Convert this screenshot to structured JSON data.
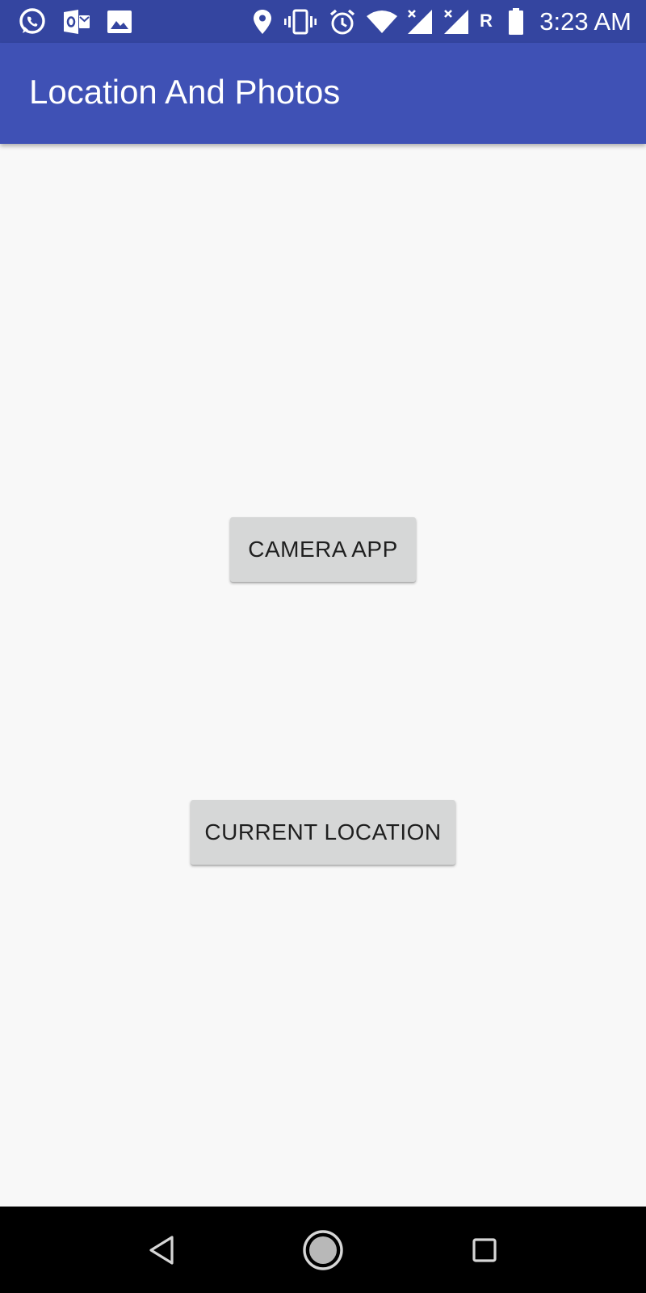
{
  "status_bar": {
    "left_icons": [
      "whatsapp-icon",
      "outlook-icon",
      "gallery-icon"
    ],
    "right_icons": [
      "location-pin-icon",
      "vibrate-icon",
      "alarm-icon",
      "wifi-icon",
      "signal-icon",
      "signal-icon",
      "roaming-indicator",
      "battery-icon"
    ],
    "roaming_label": "R",
    "time": "3:23 AM",
    "color": "#3445a0"
  },
  "app_bar": {
    "title": "Location And Photos",
    "color": "#3f51b5"
  },
  "main": {
    "buttons": [
      {
        "label": "CAMERA APP"
      },
      {
        "label": "CURRENT LOCATION"
      }
    ],
    "button_color": "#d6d7d7",
    "background": "#f8f8f8"
  },
  "nav_bar": {
    "buttons": [
      "back-icon",
      "home-icon",
      "recents-icon"
    ],
    "color": "#000000"
  }
}
